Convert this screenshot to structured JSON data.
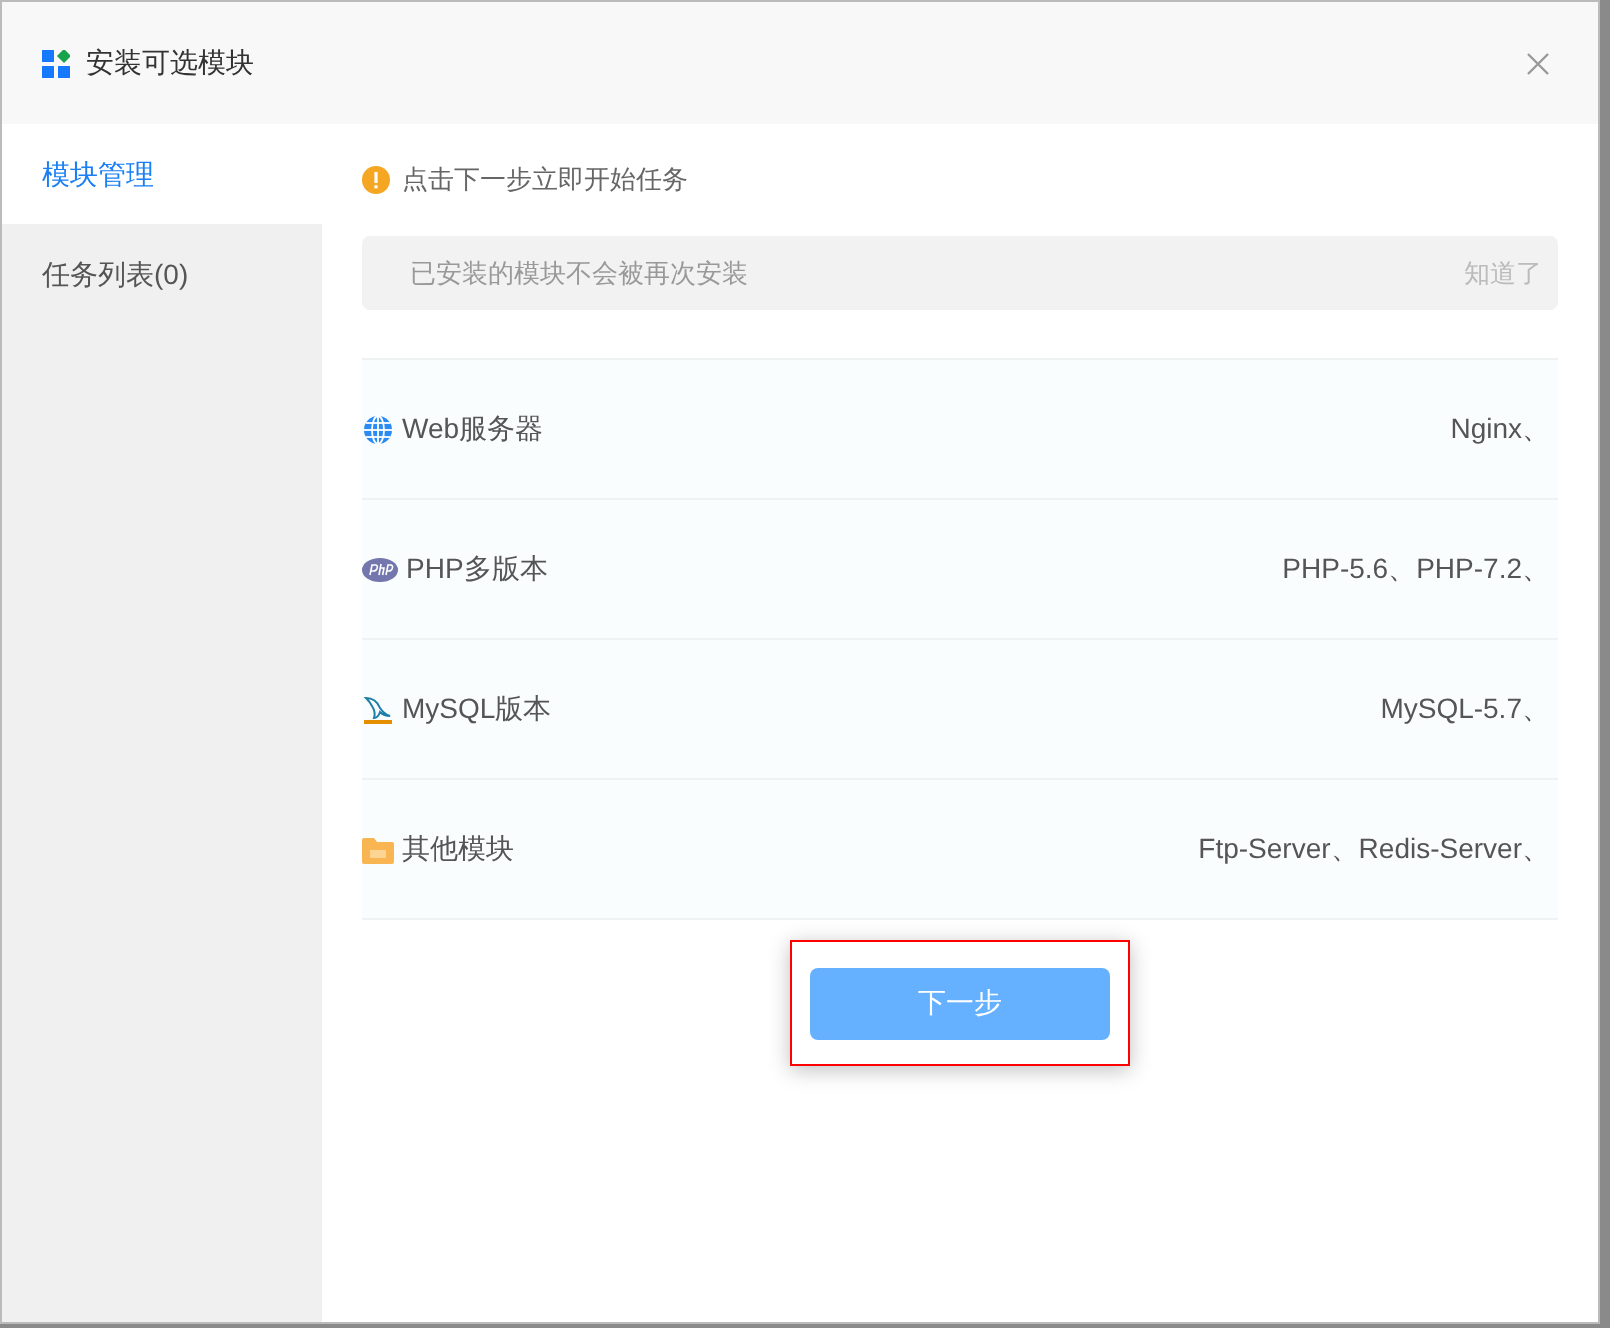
{
  "dialog": {
    "title": "安装可选模块"
  },
  "sidebar": {
    "items": [
      {
        "label": "模块管理",
        "selected": true
      },
      {
        "label": "任务列表(0)",
        "selected": false
      }
    ]
  },
  "notice": {
    "text": "点击下一步立即开始任务"
  },
  "info_bar": {
    "text": "已安装的模块不会被再次安装",
    "action": "知道了"
  },
  "modules": [
    {
      "kind": "web",
      "name": "Web服务器",
      "value": "Nginx、"
    },
    {
      "kind": "php",
      "name": "PHP多版本",
      "value": "PHP-5.6、PHP-7.2、"
    },
    {
      "kind": "mysql",
      "name": "MySQL版本",
      "value": "MySQL-5.7、"
    },
    {
      "kind": "other",
      "name": "其他模块",
      "value": "Ftp-Server、Redis-Server、"
    }
  ],
  "next_button": {
    "label": "下一步"
  }
}
